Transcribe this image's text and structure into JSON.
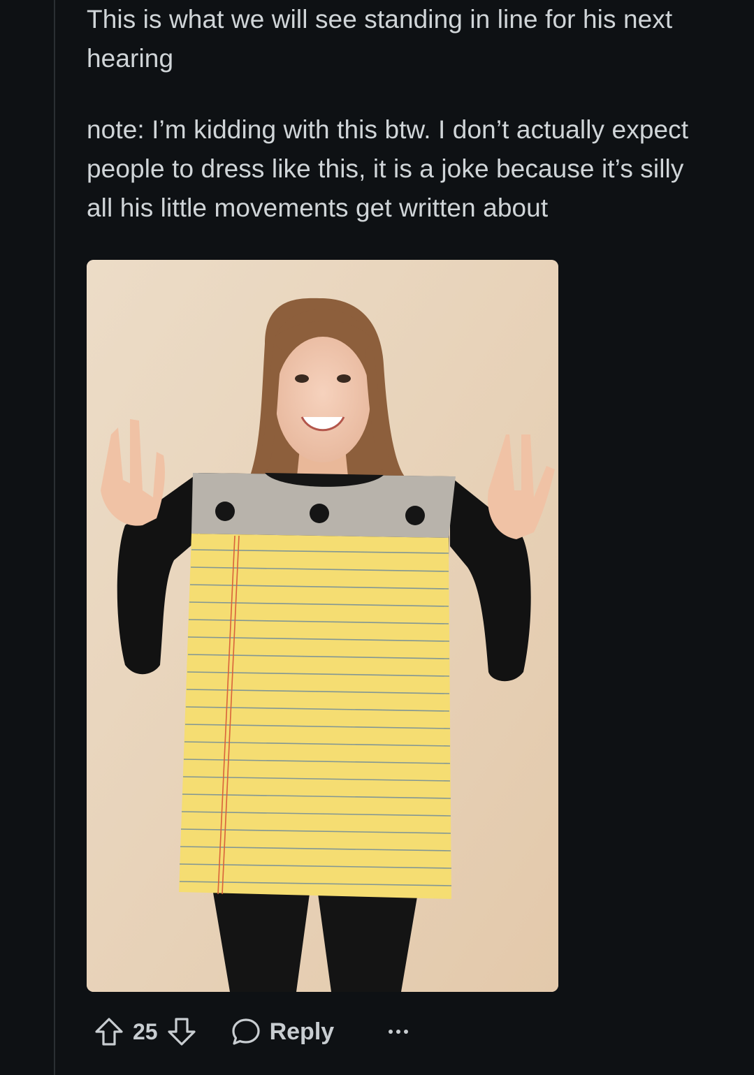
{
  "comment": {
    "paragraphs": [
      "This is what we will see standing in line for his next hearing",
      "note: I’m kidding with this btw. I don’t actually expect people to dress like this, it is a joke because it’s silly all his little movements get written about"
    ],
    "image_icon": "photo-of-woman-in-legal-pad-costume"
  },
  "actions": {
    "upvote_icon": "upvote-arrow-icon",
    "vote_count": "25",
    "downvote_icon": "downvote-arrow-icon",
    "reply_icon": "speech-bubble-icon",
    "reply_label": "Reply",
    "more_icon": "ellipsis-icon"
  },
  "colors": {
    "background": "#0e1114",
    "text": "#d0d5d8",
    "thread_line": "#2a2f33",
    "pad_yellow": "#f5dd72",
    "pad_header": "#b7b2aa"
  }
}
